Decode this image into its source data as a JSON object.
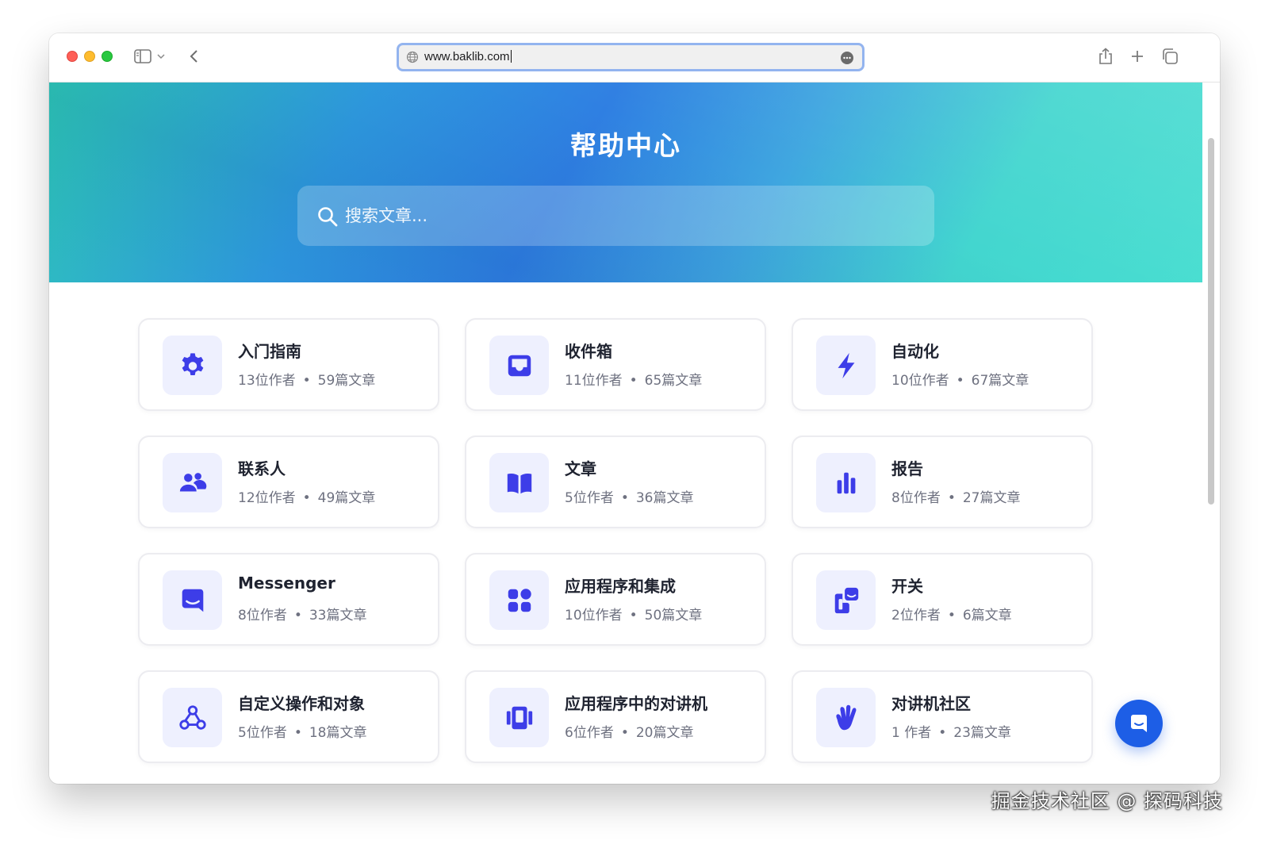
{
  "browser": {
    "url": "www.baklib.com"
  },
  "hero": {
    "title": "帮助中心",
    "search_placeholder": "搜索文章..."
  },
  "collections": [
    {
      "title": "入门指南",
      "authors": "13位作者",
      "articles": "59篇文章",
      "icon": "gear-icon"
    },
    {
      "title": "收件箱",
      "authors": "11位作者",
      "articles": "65篇文章",
      "icon": "inbox-icon"
    },
    {
      "title": "自动化",
      "authors": "10位作者",
      "articles": "67篇文章",
      "icon": "lightning-icon"
    },
    {
      "title": "联系人",
      "authors": "12位作者",
      "articles": "49篇文章",
      "icon": "people-icon"
    },
    {
      "title": "文章",
      "authors": "5位作者",
      "articles": "36篇文章",
      "icon": "book-icon"
    },
    {
      "title": "报告",
      "authors": "8位作者",
      "articles": "27篇文章",
      "icon": "bar-chart-icon"
    },
    {
      "title": "Messenger",
      "authors": "8位作者",
      "articles": "33篇文章",
      "icon": "messenger-icon"
    },
    {
      "title": "应用程序和集成",
      "authors": "10位作者",
      "articles": "50篇文章",
      "icon": "apps-grid-icon"
    },
    {
      "title": "开关",
      "authors": "2位作者",
      "articles": "6篇文章",
      "icon": "switch-icon"
    },
    {
      "title": "自定义操作和对象",
      "authors": "5位作者",
      "articles": "18篇文章",
      "icon": "webhook-icon"
    },
    {
      "title": "应用程序中的对讲机",
      "authors": "6位作者",
      "articles": "20篇文章",
      "icon": "carousel-icon"
    },
    {
      "title": "对讲机社区",
      "authors": "1 作者",
      "articles": "23篇文章",
      "icon": "wave-hand-icon"
    }
  ],
  "watermark": "掘金技术社区 @ 探码科技",
  "colors": {
    "accent": "#3d3de8",
    "icon_bg": "#eef0fe",
    "chat_button": "#1d5ee6"
  }
}
